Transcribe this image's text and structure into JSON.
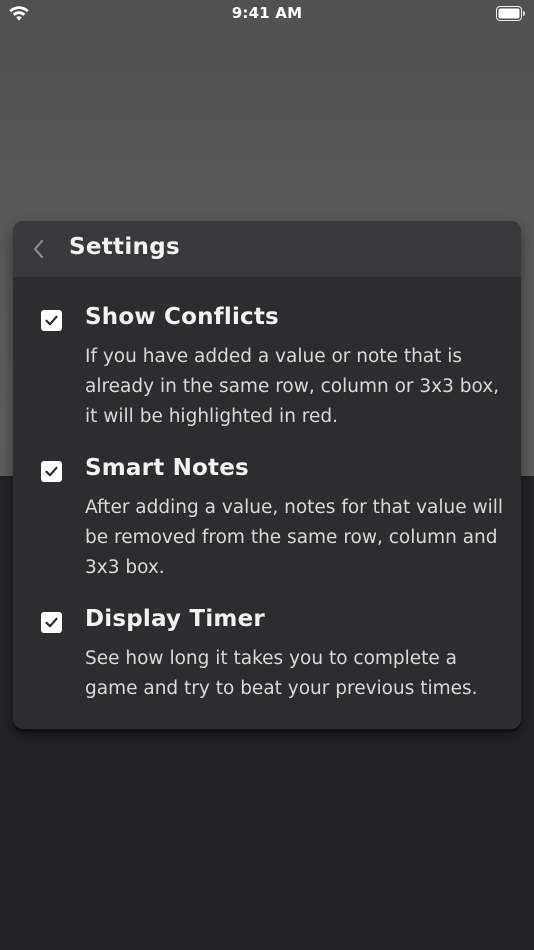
{
  "status_bar": {
    "time": "9:41 AM",
    "wifi_icon": "wifi-icon",
    "battery_icon": "battery-icon"
  },
  "modal": {
    "title": "Settings",
    "back_icon": "chevron-left-icon"
  },
  "settings": [
    {
      "title": "Show Conflicts",
      "description": "If you have added a value or note that is already in the same row, column or 3x3 box, it will be highlighted in red.",
      "checked": true
    },
    {
      "title": "Smart Notes",
      "description": "After adding a value, notes for that value will be removed from the same row, column and 3x3 box.",
      "checked": true
    },
    {
      "title": "Display Timer",
      "description": "See how long it takes you to complete a game and try to beat your previous times.",
      "checked": true
    }
  ],
  "colors": {
    "background_top": "#5b5b5b",
    "background_bottom": "#232325",
    "modal_background": "#2d2d2f",
    "modal_header": "#39393b",
    "text_primary": "#f2f2f2",
    "text_secondary": "#d9d9d9",
    "checkbox": "#ffffff"
  }
}
